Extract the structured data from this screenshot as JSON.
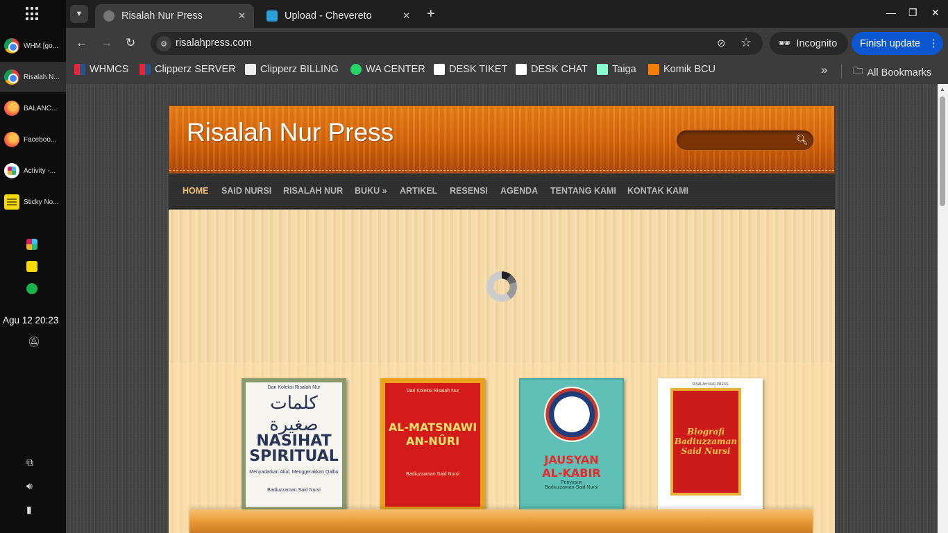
{
  "os": {
    "taskbar_items": [
      {
        "label": "WHM [go...",
        "icon": "chrome-icon"
      },
      {
        "label": "Risalah N...",
        "icon": "chrome-icon"
      },
      {
        "label": "BALANC...",
        "icon": "firefox-icon"
      },
      {
        "label": "Faceboo...",
        "icon": "firefox-icon"
      },
      {
        "label": "Activity -...",
        "icon": "slack-icon"
      },
      {
        "label": "Sticky No...",
        "icon": "sticky-notes-icon"
      }
    ],
    "clock": "Agu 12  20:23"
  },
  "browser": {
    "tabs": [
      {
        "title": "Risalah Nur Press",
        "active": true
      },
      {
        "title": "Upload - Chevereto",
        "active": false
      }
    ],
    "url": "risalahpress.com",
    "incognito_label": "Incognito",
    "finish_update_label": "Finish update",
    "bookmarks": [
      {
        "label": "WHMCS"
      },
      {
        "label": "Clipperz SERVER"
      },
      {
        "label": "Clipperz BILLING"
      },
      {
        "label": "WA CENTER"
      },
      {
        "label": "DESK TIKET"
      },
      {
        "label": "DESK CHAT"
      },
      {
        "label": "Taiga"
      },
      {
        "label": "Komik BCU"
      }
    ],
    "all_bookmarks_label": "All Bookmarks"
  },
  "site": {
    "title": "Risalah Nur Press",
    "search_placeholder": "",
    "nav": [
      {
        "label": "HOME",
        "current": true
      },
      {
        "label": "SAID NURSI"
      },
      {
        "label": "RISALAH NUR"
      },
      {
        "label": "BUKU »"
      },
      {
        "label": "ARTIKEL"
      },
      {
        "label": "RESENSI"
      },
      {
        "label": "AGENDA"
      },
      {
        "label": "TENTANG KAMI"
      },
      {
        "label": "KONTAK KAMI"
      }
    ],
    "books": [
      {
        "top_text": "Dari Koleksi Risalah Nur",
        "arabic": "كلمات صغيرة",
        "title_1": "NASIHAT",
        "title_2": "SPIRITUAL",
        "subtitle": "Menyadarkan Akal, Menggerakkan Qalbu",
        "author": "Badiuzzaman Said Nursi"
      },
      {
        "top_text": "Dari Koleksi Risalah Nur",
        "title_1": "AL-MATSNAWI",
        "title_2": "AN-NÛRI",
        "author": "Badiuzzaman Said Nursi"
      },
      {
        "title_1": "JAUSYAN",
        "title_2": "AL-KABIR",
        "author_1": "Penyusun",
        "author": "Badiuzzaman Said Nursi"
      },
      {
        "publisher": "RISALAH NUR PRESS",
        "title_1": "Biografi",
        "title_2": "Badiuzzaman",
        "title_3": "Said Nursi"
      }
    ]
  },
  "colors": {
    "header_orange": "#d8650b",
    "nav_bg": "#2e2e2e",
    "nav_current": "#f3c37a",
    "finish_update_blue": "#0b57d0"
  }
}
